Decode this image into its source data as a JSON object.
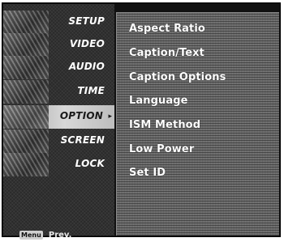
{
  "menu": {
    "items": [
      {
        "label": "SETUP",
        "selected": false
      },
      {
        "label": "VIDEO",
        "selected": false
      },
      {
        "label": "AUDIO",
        "selected": false
      },
      {
        "label": "TIME",
        "selected": false
      },
      {
        "label": "OPTION",
        "selected": true
      },
      {
        "label": "SCREEN",
        "selected": false
      },
      {
        "label": "LOCK",
        "selected": false
      }
    ],
    "selected_arrow": "▸"
  },
  "footer": {
    "menu_key": "Menu",
    "prev_label": "Prev."
  },
  "options": {
    "items": [
      "Aspect Ratio",
      "Caption/Text",
      "Caption Options",
      "Language",
      "ISM Method",
      "Low Power",
      "Set ID"
    ]
  }
}
